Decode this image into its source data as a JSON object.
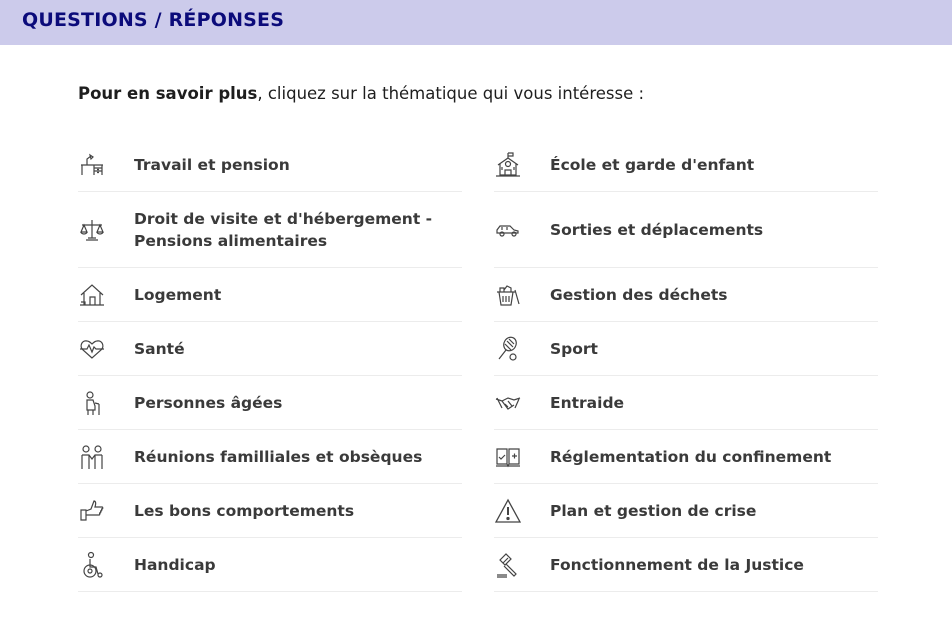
{
  "header": {
    "title": "QUESTIONS / RÉPONSES",
    "background": "#cccbeb",
    "title_color": "#0b0b7a"
  },
  "intro": {
    "bold": "Pour en savoir plus",
    "rest": ", cliquez sur la thématique qui vous intéresse :"
  },
  "left_items": [
    {
      "label": "Travail et pension",
      "icon": "desk-lamp-icon"
    },
    {
      "label": "Droit de visite et d'hébergement - Pensions alimentaires",
      "line1": "Droit de visite et d'hébergement -",
      "line2": "Pensions alimentaires",
      "icon": "scales-icon"
    },
    {
      "label": "Logement",
      "icon": "house-icon"
    },
    {
      "label": "Santé",
      "icon": "heart-pulse-icon"
    },
    {
      "label": "Personnes âgées",
      "icon": "elderly-person-icon"
    },
    {
      "label": "Réunions familliales et obsèques",
      "icon": "people-greeting-icon"
    },
    {
      "label": "Les bons comportements",
      "icon": "thumbs-up-icon"
    },
    {
      "label": "Handicap",
      "icon": "wheelchair-icon"
    }
  ],
  "right_items": [
    {
      "label": "École et garde d'enfant",
      "icon": "school-icon"
    },
    {
      "label": "Sorties et déplacements",
      "icon": "car-icon"
    },
    {
      "label": "Gestion des déchets",
      "icon": "trash-bin-icon"
    },
    {
      "label": "Sport",
      "icon": "tennis-racket-icon"
    },
    {
      "label": "Entraide",
      "icon": "handshake-icon"
    },
    {
      "label": "Réglementation du confinement",
      "icon": "rulebook-icon"
    },
    {
      "label": "Plan et gestion de crise",
      "icon": "warning-icon"
    },
    {
      "label": "Fonctionnement de la Justice",
      "icon": "gavel-icon"
    }
  ]
}
